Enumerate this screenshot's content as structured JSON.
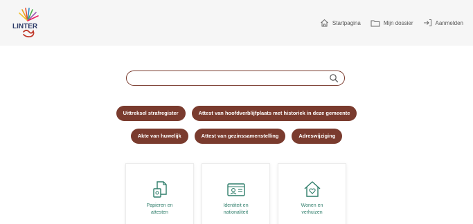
{
  "colors": {
    "brand": "#7a3b2e",
    "accent_green": "#2e7d6a",
    "header_bg": "#f6f6f6"
  },
  "header": {
    "logo_text": "LINTER",
    "nav": [
      {
        "icon": "home-icon",
        "label": "Startpagina"
      },
      {
        "icon": "folder-icon",
        "label": "Mijn dossier"
      },
      {
        "icon": "login-icon",
        "label": "Aanmelden"
      }
    ]
  },
  "search": {
    "value": "",
    "placeholder": ""
  },
  "chips": {
    "row1": [
      {
        "label": "Uittreksel strafregister"
      },
      {
        "label": "Attest van hoofdverblijfplaats met historiek in deze gemeente"
      }
    ],
    "row2": [
      {
        "label": "Akte van huwelijk"
      },
      {
        "label": "Attest van gezinssamenstelling"
      },
      {
        "label": "Adreswijziging"
      }
    ]
  },
  "cards": [
    {
      "icon": "documents-icon",
      "label_line1": "Papieren en",
      "label_line2": "attesten"
    },
    {
      "icon": "id-card-icon",
      "label_line1": "Identiteit en",
      "label_line2": "nationaliteit"
    },
    {
      "icon": "home-heart-icon",
      "label_line1": "Wonen en",
      "label_line2": "verhuizen"
    }
  ]
}
